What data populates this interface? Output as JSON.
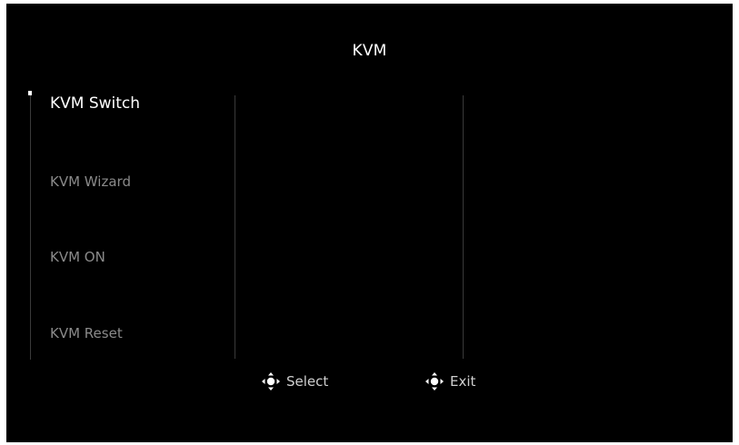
{
  "screen": {
    "title": "KVM"
  },
  "menu": {
    "items": [
      {
        "label": "KVM Switch",
        "selected": true
      },
      {
        "label": "KVM Wizard",
        "selected": false
      },
      {
        "label": "KVM ON",
        "selected": false
      },
      {
        "label": "KVM Reset",
        "selected": false
      }
    ]
  },
  "footer": {
    "select_label": "Select",
    "select_icon": "joystick-directional-icon",
    "exit_label": "Exit",
    "exit_icon": "joystick-directional-icon"
  },
  "colors": {
    "background": "#000000",
    "text_active": "#ffffff",
    "text_inactive": "#8a8a8a",
    "divider": "#3a3a3a"
  }
}
